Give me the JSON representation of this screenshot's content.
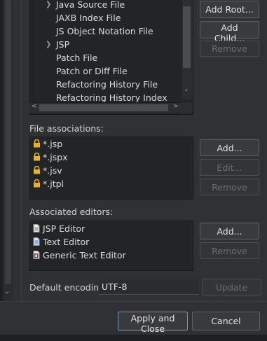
{
  "file_types": {
    "items": [
      {
        "label": "Java Source File",
        "expandable": true
      },
      {
        "label": "JAXB Index File",
        "expandable": false
      },
      {
        "label": "JS Object Notation File",
        "expandable": false
      },
      {
        "label": "JSP",
        "expandable": true
      },
      {
        "label": "Patch File",
        "expandable": false
      },
      {
        "label": "Patch or Diff File",
        "expandable": false
      },
      {
        "label": "Refactoring History File",
        "expandable": false
      },
      {
        "label": "Refactoring History Index",
        "expandable": false
      }
    ],
    "buttons": {
      "add_root": "Add Root...",
      "add_child": "Add Child...",
      "remove": "Remove"
    }
  },
  "file_associations": {
    "label": "File associations:",
    "items": [
      "*.jsp",
      "*.jspx",
      "*.jsv",
      "*.jtpl"
    ],
    "buttons": {
      "add": "Add...",
      "edit": "Edit...",
      "remove": "Remove"
    }
  },
  "associated_editors": {
    "label": "Associated editors:",
    "items": [
      {
        "label": "JSP Editor",
        "icon": "jsp-editor-icon"
      },
      {
        "label": "Text Editor",
        "icon": "text-editor-icon"
      },
      {
        "label": "Generic Text Editor",
        "icon": "generic-editor-icon"
      }
    ],
    "buttons": {
      "add": "Add...",
      "remove": "Remove"
    }
  },
  "encoding": {
    "label": "Default encoding:",
    "value": "UTF-8",
    "update_button": "Update"
  },
  "footer": {
    "apply_close": "Apply and Close",
    "cancel": "Cancel"
  },
  "colors": {
    "background": "#2f3133",
    "list_background": "#222426",
    "lock_icon": "#e8b12a",
    "primary_border": "#7d96b7"
  }
}
